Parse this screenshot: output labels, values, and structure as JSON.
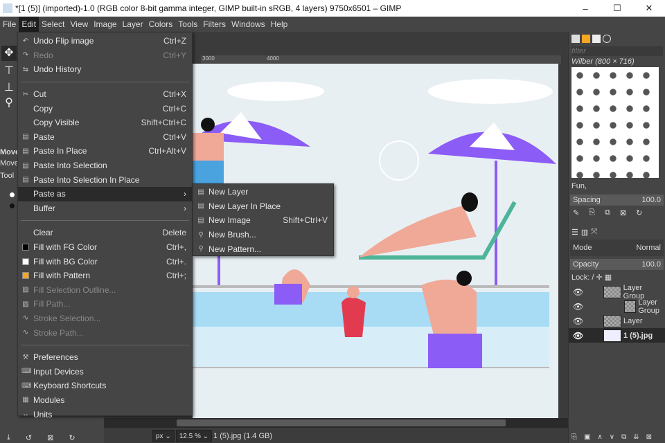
{
  "window": {
    "title": "*[1 (5)] (imported)-1.0 (RGB color 8-bit gamma integer, GIMP built-in sRGB, 4 layers) 9750x6501 – GIMP",
    "minimize": "–",
    "maximize": "☐",
    "close": "✕"
  },
  "menubar": [
    "File",
    "Edit",
    "Select",
    "View",
    "Image",
    "Layer",
    "Colors",
    "Tools",
    "Filters",
    "Windows",
    "Help"
  ],
  "toolbox": {
    "tool_name": "Move",
    "tool_sub": "Move",
    "tool_label": "Tool"
  },
  "ruler": [
    "3000",
    "4000"
  ],
  "edit_menu": [
    {
      "label": "Undo Flip image",
      "shortcut": "Ctrl+Z",
      "icon": "undo-icon"
    },
    {
      "label": "Redo",
      "shortcut": "Ctrl+Y",
      "icon": "redo-icon",
      "disabled": true
    },
    {
      "label": "Undo History",
      "shortcut": "",
      "icon": "history-icon"
    },
    {
      "sep": true
    },
    {
      "label": "Cut",
      "shortcut": "Ctrl+X",
      "icon": "scissors-icon"
    },
    {
      "label": "Copy",
      "shortcut": "Ctrl+C",
      "icon": "copy-icon"
    },
    {
      "label": "Copy Visible",
      "shortcut": "Shift+Ctrl+C"
    },
    {
      "label": "Paste",
      "shortcut": "Ctrl+V",
      "icon": "paste-icon"
    },
    {
      "label": "Paste In Place",
      "shortcut": "Ctrl+Alt+V",
      "icon": "paste-icon"
    },
    {
      "label": "Paste Into Selection",
      "shortcut": "",
      "icon": "paste-icon"
    },
    {
      "label": "Paste Into Selection In Place",
      "shortcut": "",
      "icon": "paste-icon"
    },
    {
      "label": "Paste as",
      "shortcut": "",
      "submenu": true,
      "highlighted": true
    },
    {
      "label": "Buffer",
      "shortcut": "",
      "submenu": true
    },
    {
      "sep": true
    },
    {
      "label": "Clear",
      "shortcut": "Delete",
      "icon": "clear-icon"
    },
    {
      "label": "Fill with FG Color",
      "shortcut": "Ctrl+,",
      "swatch": "#000000"
    },
    {
      "label": "Fill with BG Color",
      "shortcut": "Ctrl+.",
      "swatch": "#ffffff"
    },
    {
      "label": "Fill with Pattern",
      "shortcut": "Ctrl+;",
      "swatch": "#f5a623"
    },
    {
      "label": "Fill Selection Outline...",
      "shortcut": "",
      "icon": "fill-icon",
      "disabled": true
    },
    {
      "label": "Fill Path...",
      "shortcut": "",
      "icon": "fill-icon",
      "disabled": true
    },
    {
      "label": "Stroke Selection...",
      "shortcut": "",
      "icon": "stroke-icon",
      "disabled": true
    },
    {
      "label": "Stroke Path...",
      "shortcut": "",
      "icon": "stroke-icon",
      "disabled": true
    },
    {
      "sep": true
    },
    {
      "label": "Preferences",
      "shortcut": "",
      "icon": "preferences-icon"
    },
    {
      "label": "Input Devices",
      "shortcut": "",
      "icon": "input-devices-icon"
    },
    {
      "label": "Keyboard Shortcuts",
      "shortcut": "",
      "icon": "keyboard-icon"
    },
    {
      "label": "Modules",
      "shortcut": "",
      "icon": "modules-icon"
    },
    {
      "label": "Units",
      "shortcut": "",
      "icon": "units-icon"
    }
  ],
  "paste_as_menu": [
    {
      "label": "New Layer",
      "shortcut": ""
    },
    {
      "label": "New Layer In Place",
      "shortcut": ""
    },
    {
      "label": "New Image",
      "shortcut": "Shift+Ctrl+V"
    },
    {
      "label": "New Brush...",
      "shortcut": ""
    },
    {
      "label": "New Pattern...",
      "shortcut": ""
    }
  ],
  "status": {
    "unit": "px",
    "zoom": "12.5 %",
    "info": "1 (5).jpg (1.4 GB)"
  },
  "brushes": {
    "filter_placeholder": "filter",
    "brush_name": "Wilber (800 × 716)",
    "tag": "Fun,",
    "spacing_label": "Spacing",
    "spacing_value": "100.0"
  },
  "layers": {
    "mode_label": "Mode",
    "mode_value": "Normal",
    "opacity_label": "Opacity",
    "opacity_value": "100.0",
    "lock_label": "Lock:",
    "items": [
      {
        "name": "Layer Group"
      },
      {
        "name": "Layer Group"
      },
      {
        "name": "Layer"
      },
      {
        "name": "1 (5).jpg",
        "active": true
      }
    ]
  },
  "colors": {
    "accent_purple": "#8b5cf6",
    "pool": "#a8dcf5",
    "menu_bg": "#454545",
    "highlight": "#2a2a2a"
  }
}
